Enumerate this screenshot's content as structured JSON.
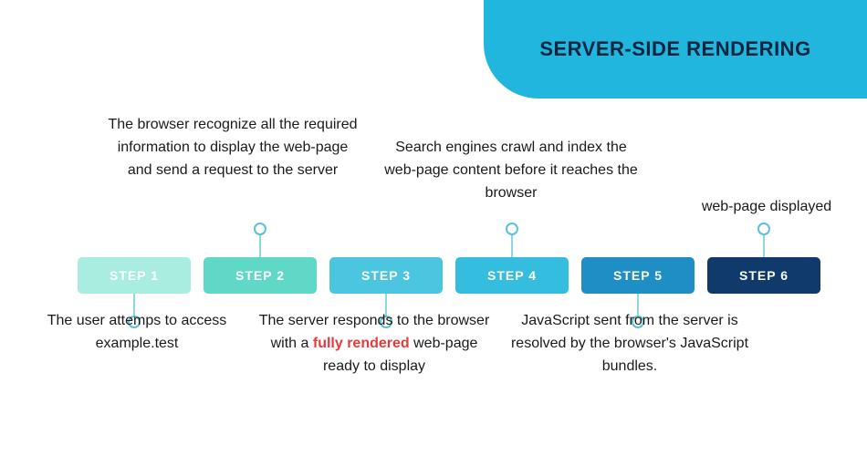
{
  "header": {
    "title": "SERVER-SIDE RENDERING"
  },
  "steps": [
    {
      "label": "STEP 1"
    },
    {
      "label": "STEP 2"
    },
    {
      "label": "STEP 3"
    },
    {
      "label": "STEP 4"
    },
    {
      "label": "STEP 5"
    },
    {
      "label": "STEP 6"
    }
  ],
  "annotations": {
    "s1": "The user attemps to access example.test",
    "s2": "The browser recognize all the required information to display the web-page and send a request to the server",
    "s3_pre": "The server responds to the browser with a ",
    "s3_hl": "fully rendered",
    "s3_post": " web-page ready to display",
    "s4": "Search engines crawl and index the web-page content before it reaches the browser",
    "s5": "JavaScript sent from the server is resolved by the browser's JavaScript bundles.",
    "s6": "web-page displayed"
  },
  "colors": {
    "accent": "#21b6dd",
    "step1": "#a9ede0",
    "step2": "#5fd8c8",
    "step3": "#4cc6e0",
    "step4": "#35bde0",
    "step5": "#1f8ec4",
    "step6": "#0f3a6b",
    "highlight": "#e83a3a"
  }
}
